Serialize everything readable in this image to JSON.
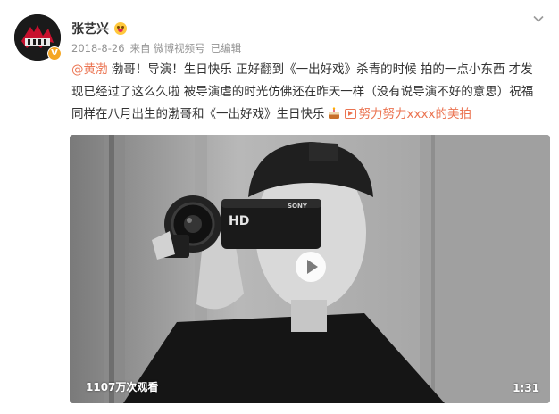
{
  "post": {
    "username": "张艺兴",
    "timestamp": "2018-8-26",
    "source": "来自 微博视频号",
    "edited": "已编辑",
    "text": {
      "mention": "@黄渤",
      "line1_rest": " 渤哥！导演！生日快乐 正好翻到《一出好戏》杀青的时候 拍的一点小东西 才发",
      "line2": "现已经过了这么久啦 被导演虐的时光仿佛还在昨天一样（没有说导演不好的意思）祝福",
      "line3": "同样在八月出生的渤哥和《一出好戏》生日快乐",
      "video_link": "努力努力xxxx的美拍"
    },
    "icons": {
      "avatar": "avatar-image",
      "verified": "verified-badge-icon",
      "user_badge": "emoji-badge-icon",
      "menu": "chevron-down-icon",
      "cake": "cake-icon",
      "video_link": "video-link-icon",
      "play": "play-icon"
    },
    "colors": {
      "link": "#eb7350",
      "meta": "#939393",
      "verified": "#f5a623"
    }
  },
  "video": {
    "views": "1107万次观看",
    "duration": "1:31",
    "camera_brand": "SONY",
    "camera_label": "HD"
  }
}
